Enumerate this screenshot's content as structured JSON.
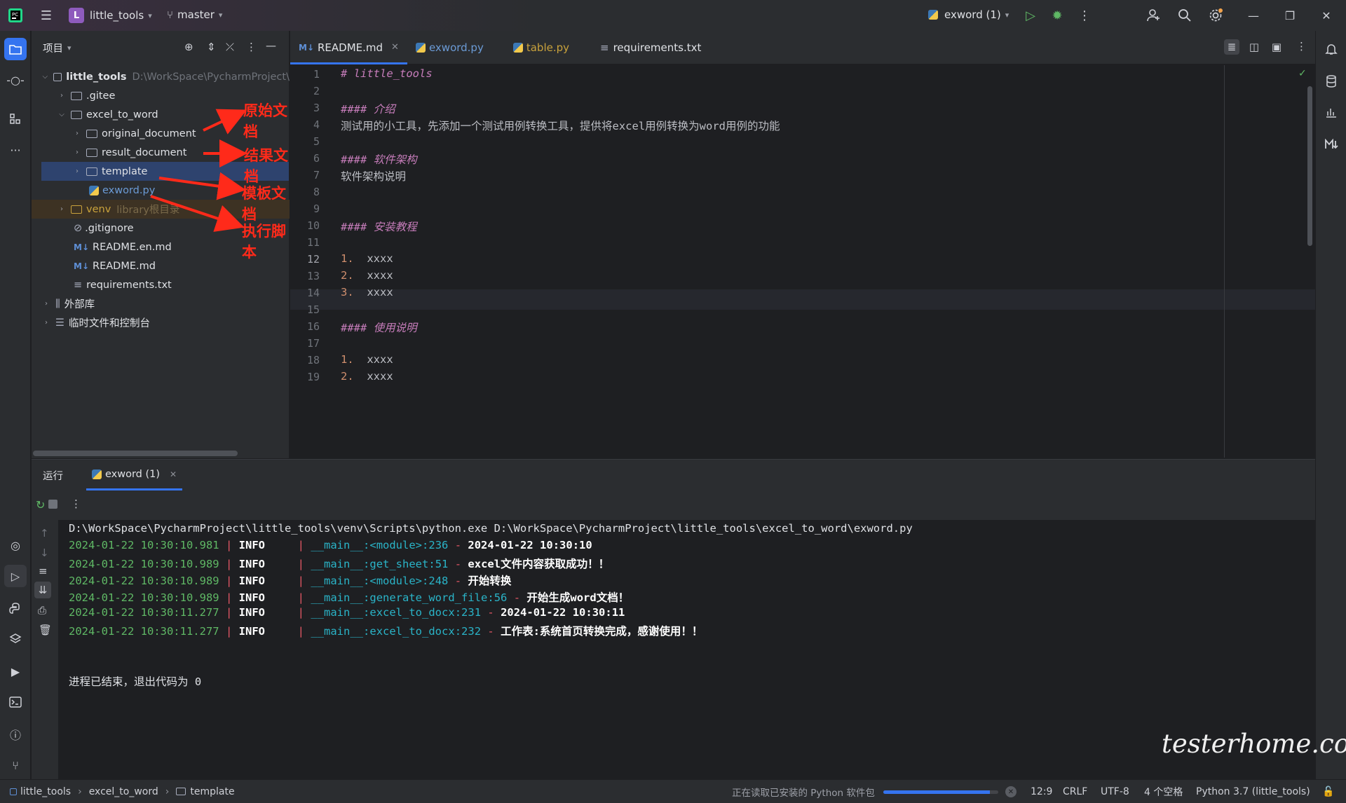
{
  "titlebar": {
    "project_badge": "L",
    "project_name": "little_tools",
    "branch": "master",
    "run_config": "exword (1)"
  },
  "project_panel": {
    "title": "项目",
    "tree": [
      {
        "label": "little_tools",
        "extra": "D:\\WorkSpace\\PycharmProject\\"
      },
      {
        "label": ".gitee"
      },
      {
        "label": "excel_to_word"
      },
      {
        "label": "original_document"
      },
      {
        "label": "result_document"
      },
      {
        "label": "template"
      },
      {
        "label": "exword.py"
      },
      {
        "label": "venv",
        "extra": "library根目录"
      },
      {
        "label": ".gitignore"
      },
      {
        "label": "README.en.md"
      },
      {
        "label": "README.md"
      },
      {
        "label": "requirements.txt"
      },
      {
        "label": "外部库"
      },
      {
        "label": "临时文件和控制台"
      }
    ],
    "annotations": [
      "原始文档",
      "结果文档",
      "模板文档",
      "执行脚本"
    ]
  },
  "tabs": [
    {
      "label": "README.md",
      "icon": "M↓"
    },
    {
      "label": "exword.py"
    },
    {
      "label": "table.py"
    },
    {
      "label": "requirements.txt"
    }
  ],
  "editor": {
    "lines": [
      {
        "n": "1",
        "text": "# little_tools"
      },
      {
        "n": "2",
        "text": ""
      },
      {
        "n": "3",
        "text": "#### 介绍"
      },
      {
        "n": "4",
        "text": "测试用的小工具，先添加一个测试用例转换工具，提供将excel用例转换为word用例的功能"
      },
      {
        "n": "5",
        "text": ""
      },
      {
        "n": "6",
        "text": "#### 软件架构"
      },
      {
        "n": "7",
        "text": "软件架构说明"
      },
      {
        "n": "8",
        "text": ""
      },
      {
        "n": "9",
        "text": ""
      },
      {
        "n": "10",
        "text": "#### 安装教程"
      },
      {
        "n": "11",
        "text": ""
      },
      {
        "n": "12",
        "mark": "1.",
        "text": "xxxx"
      },
      {
        "n": "13",
        "mark": "2.",
        "text": "xxxx"
      },
      {
        "n": "14",
        "mark": "3.",
        "text": "xxxx"
      },
      {
        "n": "15",
        "text": ""
      },
      {
        "n": "16",
        "text": "#### 使用说明"
      },
      {
        "n": "17",
        "text": ""
      },
      {
        "n": "18",
        "mark": "1.",
        "text": "xxxx"
      },
      {
        "n": "19",
        "mark": "2.",
        "text": "xxxx"
      }
    ]
  },
  "run_panel": {
    "title": "运行",
    "tab": "exword (1)",
    "command": "D:\\WorkSpace\\PycharmProject\\little_tools\\venv\\Scripts\\python.exe D:\\WorkSpace\\PycharmProject\\little_tools\\excel_to_word\\exword.py",
    "logs": [
      {
        "time": "2024-01-22 10:30:10.981",
        "level": "INFO",
        "module": "__main__",
        "func": "<module>",
        "line": "236",
        "msg": "2024-01-22 10:30:10"
      },
      {
        "time": "2024-01-22 10:30:10.989",
        "level": "INFO",
        "module": "__main__",
        "func": "get_sheet",
        "line": "51",
        "msg": "excel文件内容获取成功！！"
      },
      {
        "time": "2024-01-22 10:30:10.989",
        "level": "INFO",
        "module": "__main__",
        "func": "<module>",
        "line": "248",
        "msg": "开始转换"
      },
      {
        "time": "2024-01-22 10:30:10.989",
        "level": "INFO",
        "module": "__main__",
        "func": "generate_word_file",
        "line": "56",
        "msg": "开始生成word文档！"
      },
      {
        "time": "2024-01-22 10:30:11.277",
        "level": "INFO",
        "module": "__main__",
        "func": "excel_to_docx",
        "line": "231",
        "msg": "2024-01-22 10:30:11"
      },
      {
        "time": "2024-01-22 10:30:11.277",
        "level": "INFO",
        "module": "__main__",
        "func": "excel_to_docx",
        "line": "232",
        "msg": "工作表:系统首页转换完成，感谢使用！！"
      }
    ],
    "exit_message": "进程已结束，退出代码为 0"
  },
  "statusbar": {
    "breadcrumb": [
      "little_tools",
      "excel_to_word",
      "template"
    ],
    "task": "正在读取已安装的 Python 软件包",
    "progress": 0.93,
    "position": "12:9",
    "line_sep": "CRLF",
    "encoding": "UTF-8",
    "indent": "4 个空格",
    "interpreter": "Python 3.7 (little_tools)"
  },
  "watermark": "testerhome.com",
  "colors": {
    "accent": "#3574f0",
    "annotation": "#ff2a1a",
    "log_time": "#5fb865",
    "log_module": "#2ab4c8",
    "log_sep": "#e55765"
  }
}
